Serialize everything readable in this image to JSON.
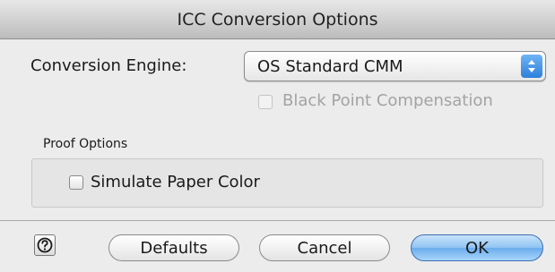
{
  "window": {
    "title": "ICC Conversion Options"
  },
  "conversion": {
    "engine_label": "Conversion Engine:",
    "engine_value": "OS Standard CMM",
    "black_point_label": "Black Point Compensation",
    "black_point_checked": false
  },
  "proof": {
    "group_label": "Proof Options",
    "simulate_paper_label": "Simulate Paper Color",
    "simulate_paper_checked": false
  },
  "buttons": {
    "defaults": "Defaults",
    "cancel": "Cancel",
    "ok": "OK"
  },
  "icons": {
    "help": "help-icon",
    "popup_arrows": "up-down-arrows-icon"
  }
}
